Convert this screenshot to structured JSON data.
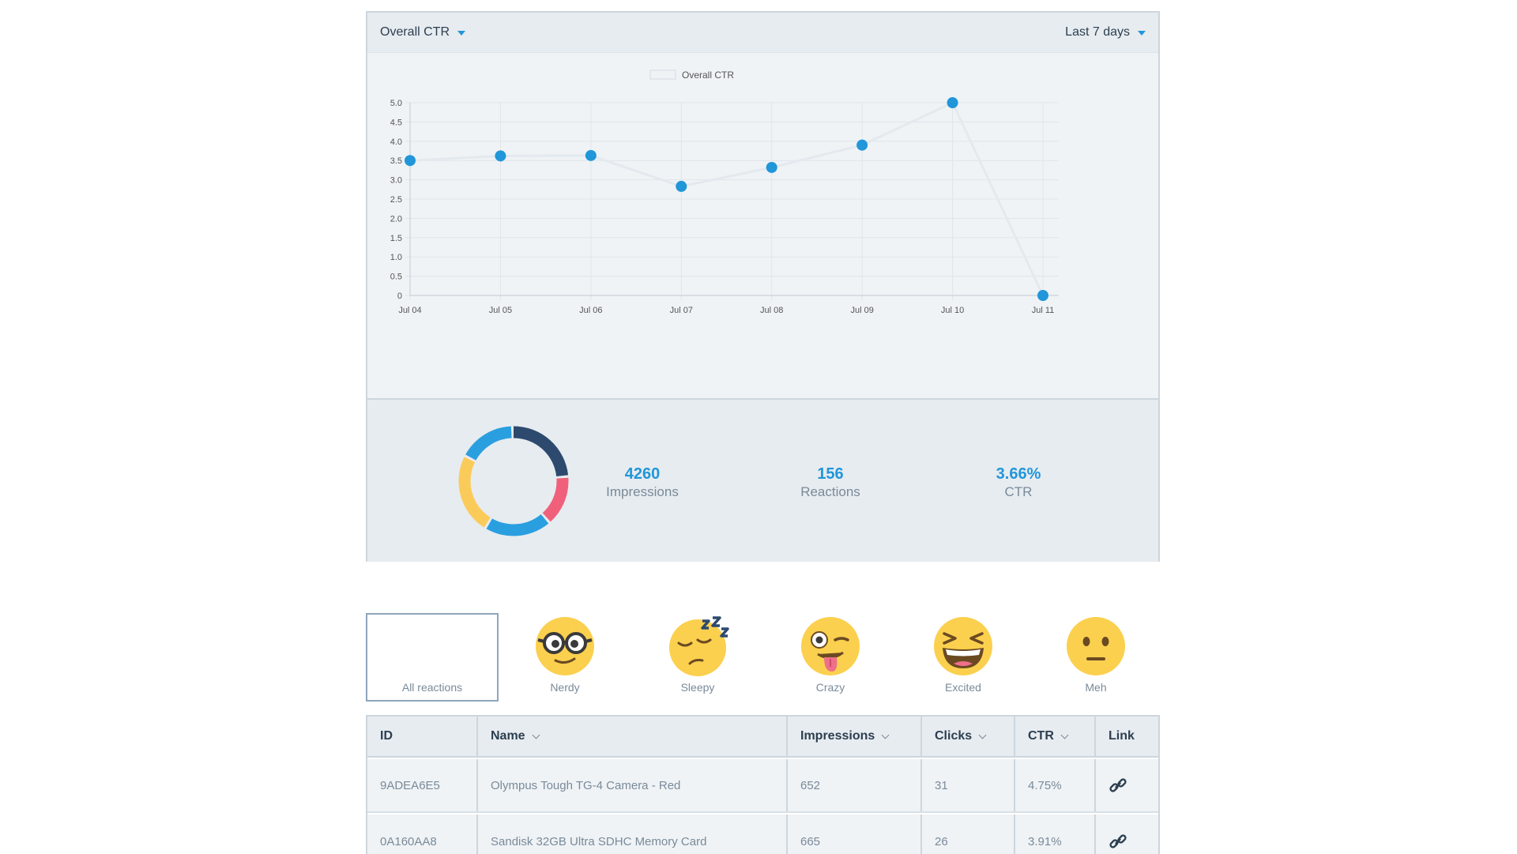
{
  "header": {
    "metric_label": "Overall CTR",
    "range_label": "Last 7 days"
  },
  "chart_data": {
    "type": "line",
    "legend": "Overall CTR",
    "legend_position": "top-center",
    "x": [
      "Jul 04",
      "Jul 05",
      "Jul 06",
      "Jul 07",
      "Jul 08",
      "Jul 09",
      "Jul 10",
      "Jul 11"
    ],
    "series": [
      {
        "name": "Overall CTR",
        "values": [
          3.5,
          3.62,
          3.63,
          2.83,
          3.32,
          3.9,
          5.0,
          0
        ]
      }
    ],
    "yticks": [
      "0",
      "0.5",
      "1.0",
      "1.5",
      "2.0",
      "2.5",
      "3.0",
      "3.5",
      "4.0",
      "4.5",
      "5.0"
    ],
    "ylim": [
      0,
      5
    ],
    "grid": true,
    "point_color": "#2196d9",
    "line_color": "#e3e9ee"
  },
  "donut": {
    "segments": [
      {
        "value": 0.24,
        "color": "#2d4a6e"
      },
      {
        "value": 0.15,
        "color": "#f0607a"
      },
      {
        "value": 0.2,
        "color": "#2a9fe0"
      },
      {
        "value": 0.24,
        "color": "#fbcb5a"
      },
      {
        "value": 0.17,
        "color": "#2a9fe0"
      }
    ]
  },
  "stats": {
    "impressions_value": "4260",
    "impressions_label": "Impressions",
    "reactions_value": "156",
    "reactions_label": "Reactions",
    "ctr_value": "3.66%",
    "ctr_label": "CTR"
  },
  "reactions": {
    "all": "All reactions",
    "nerdy": "Nerdy",
    "sleepy": "Sleepy",
    "crazy": "Crazy",
    "excited": "Excited",
    "meh": "Meh"
  },
  "table": {
    "headers": {
      "id": "ID",
      "name": "Name",
      "impressions": "Impressions",
      "clicks": "Clicks",
      "ctr": "CTR",
      "link": "Link"
    },
    "rows": [
      {
        "id": "9ADEA6E5",
        "name": "Olympus Tough TG-4 Camera - Red",
        "impressions": "652",
        "clicks": "31",
        "ctr": "4.75%"
      },
      {
        "id": "0A160AA8",
        "name": "Sandisk 32GB Ultra SDHC Memory Card",
        "impressions": "665",
        "clicks": "26",
        "ctr": "3.91%"
      }
    ]
  },
  "colors": {
    "accent": "#2196d9",
    "emoji_face": "#fbd04e"
  }
}
